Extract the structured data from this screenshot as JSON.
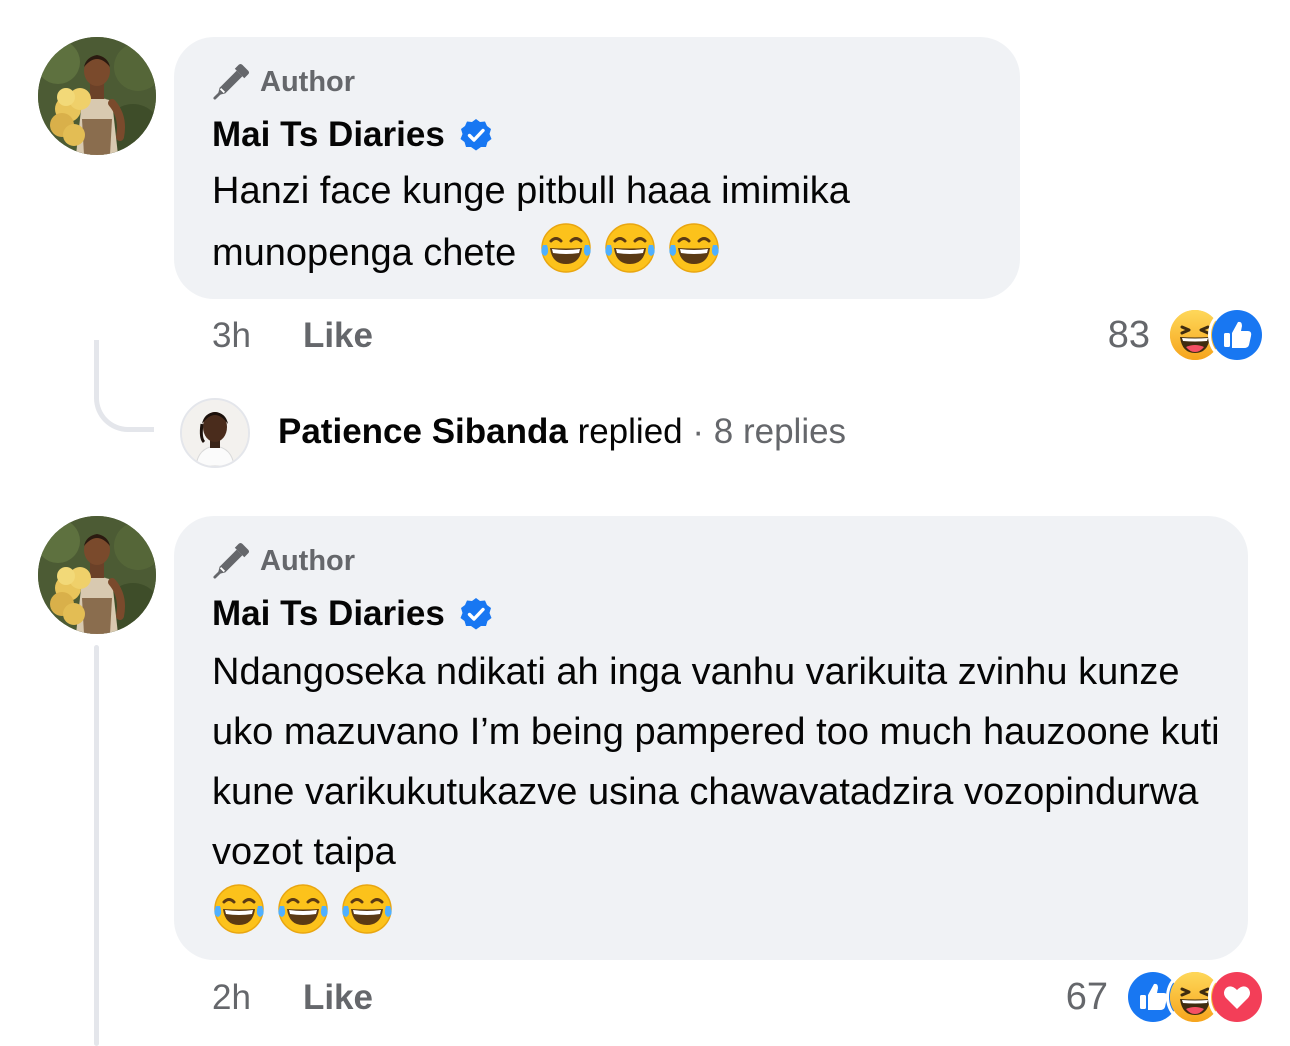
{
  "comments": [
    {
      "badge_label": "Author",
      "author_name": "Mai Ts Diaries",
      "text": "Hanzi face kunge pitbull haaa imimika munopenga chete",
      "emojis": [
        "laughing-tears",
        "laughing-tears",
        "laughing-tears"
      ],
      "time": "3h",
      "like_label": "Like",
      "reaction_count": "83",
      "reactions": [
        "haha",
        "like"
      ]
    },
    {
      "badge_label": "Author",
      "author_name": "Mai Ts Diaries",
      "text": "Ndangoseka ndikati ah inga vanhu varikuita zvinhu kunze uko mazuvano I’m being pampered too much hauzoone kuti kune varikukutukazve usina chawavatadzira vozopindurwa vozot taipa",
      "emojis": [
        "laughing-tears",
        "laughing-tears",
        "laughing-tears"
      ],
      "time": "2h",
      "like_label": "Like",
      "reaction_count": "67",
      "reactions": [
        "like",
        "haha",
        "love"
      ]
    }
  ],
  "reply_summary": {
    "name": "Patience Sibanda",
    "action": "replied",
    "separator": "·",
    "count_text": "8 replies"
  },
  "colors": {
    "bubble": "#f0f2f5",
    "muted_text": "#65676b",
    "verified": "#1877f2",
    "like": "#1877f2",
    "love": "#f33e58",
    "haha": "#f7b125"
  }
}
